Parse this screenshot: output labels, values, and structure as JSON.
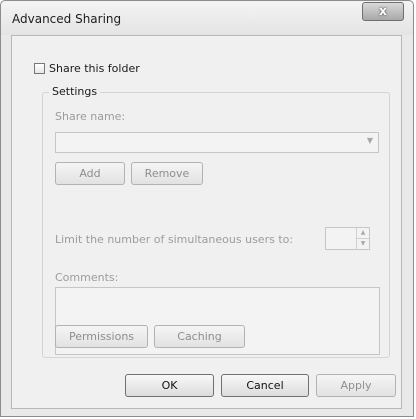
{
  "window": {
    "title": "Advanced Sharing",
    "close_label": "x"
  },
  "share_checkbox": {
    "label": "Share this folder",
    "checked": false
  },
  "settings": {
    "legend": "Settings",
    "share_name_label": "Share name:",
    "share_name_value": "",
    "add_label": "Add",
    "remove_label": "Remove",
    "limit_label": "Limit the number of simultaneous users to:",
    "limit_value": "",
    "comments_label": "Comments:",
    "comments_value": "",
    "permissions_label": "Permissions",
    "caching_label": "Caching"
  },
  "footer": {
    "ok_label": "OK",
    "cancel_label": "Cancel",
    "apply_label": "Apply"
  }
}
